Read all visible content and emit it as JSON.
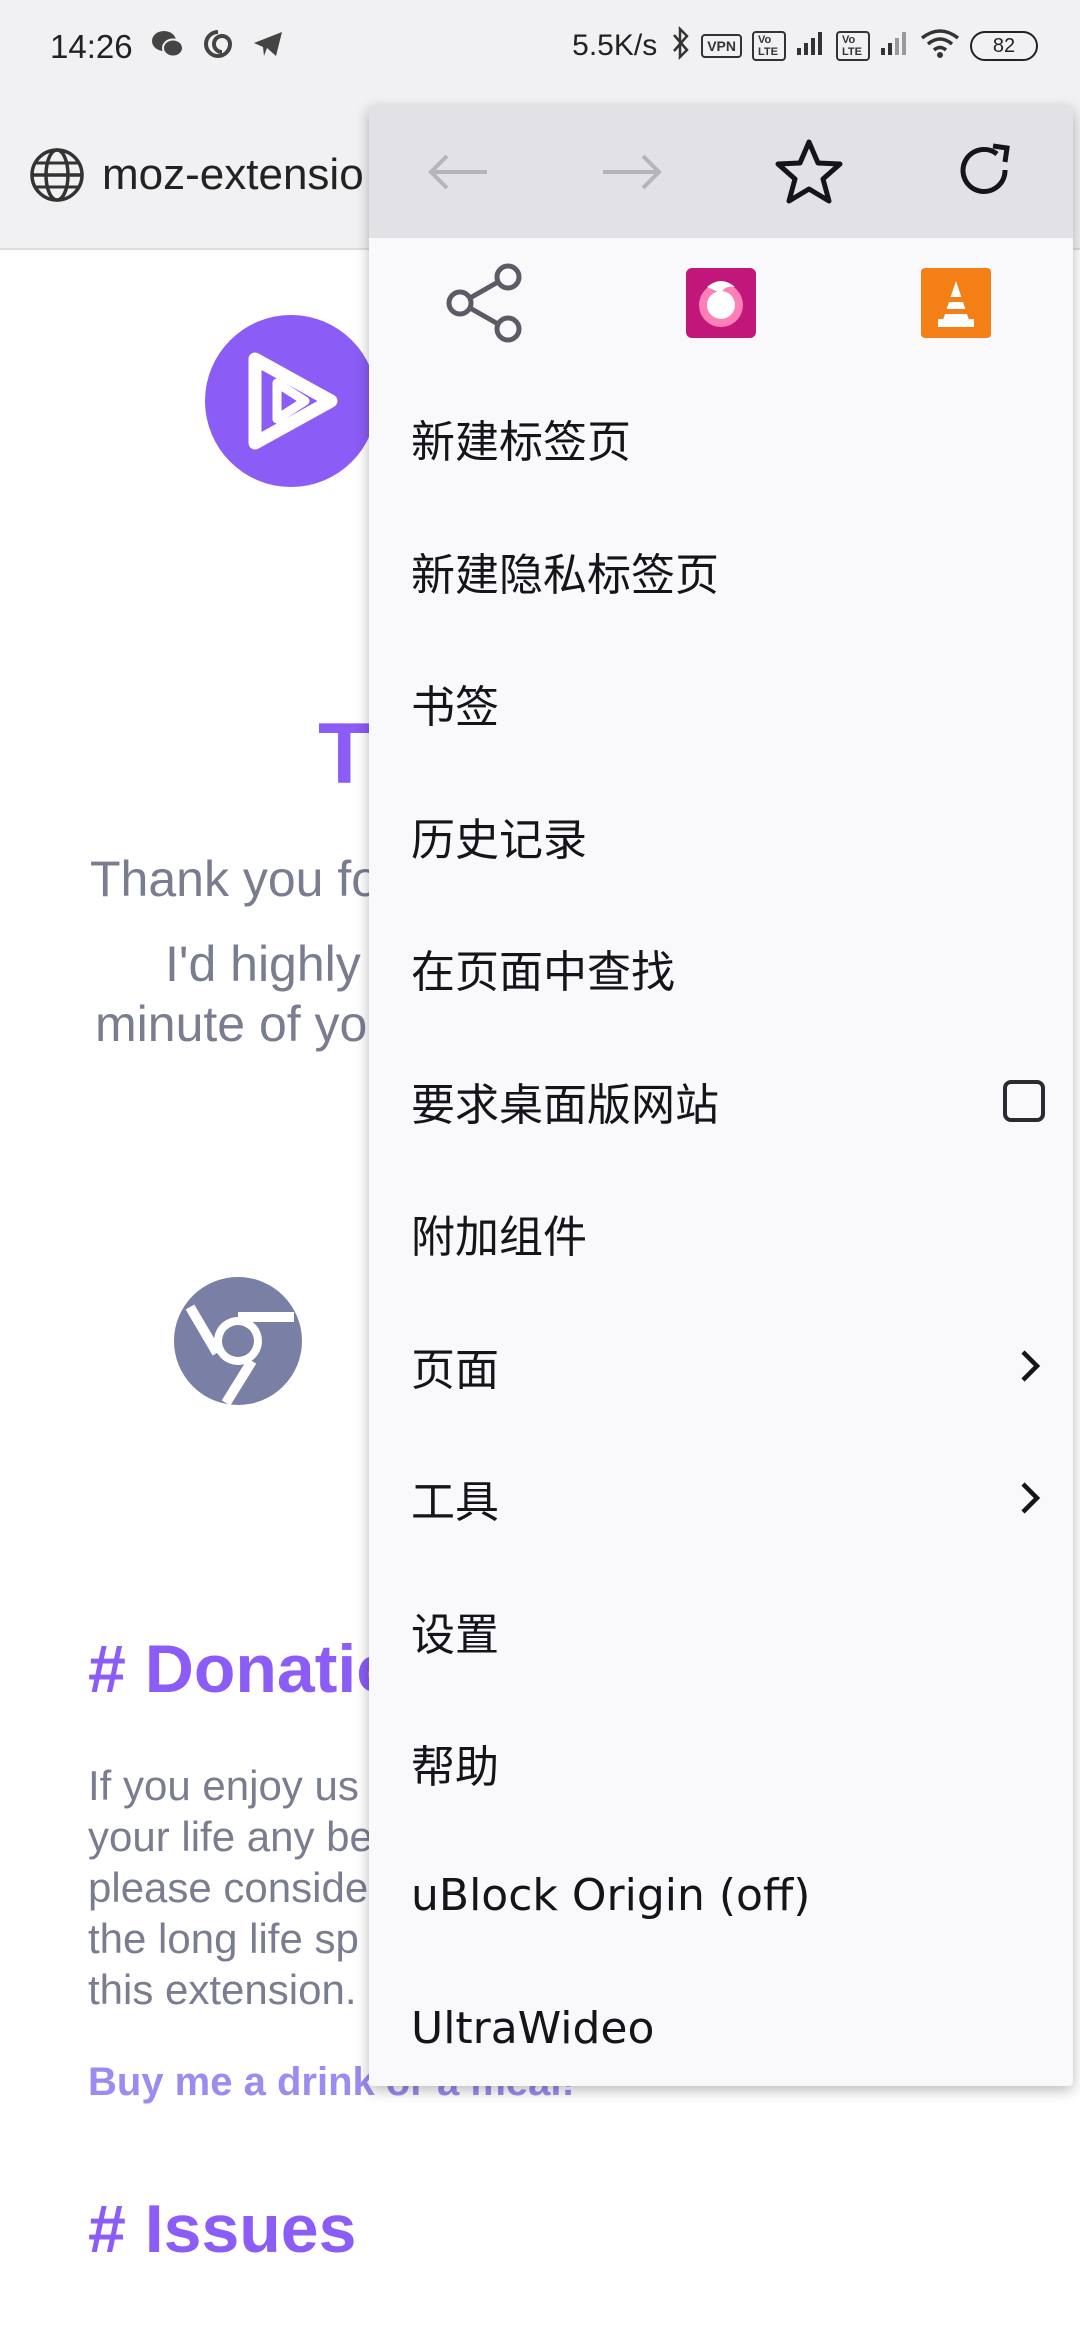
{
  "status_bar": {
    "time": "14:26",
    "speed": "5.5K/s",
    "vpn": "VPN",
    "volte1": "Vo LTE",
    "volte2": "Vo LTE",
    "battery": "82",
    "icons": [
      "wechat-icon",
      "hermes-icon",
      "telegram-icon",
      "bluetooth-icon",
      "signal-icon",
      "wifi-icon"
    ]
  },
  "url_bar": {
    "url": "moz-extensio"
  },
  "page": {
    "title_partial": "T",
    "thank_partial": "Thank you fo",
    "line1_partial": "I'd highly",
    "line2_partial": "minute of yo",
    "donation_heading": "Donatio",
    "donation_lines": [
      "If you enjoy us",
      "your life any be",
      "please conside",
      "the long life sp",
      "this extension."
    ],
    "donate_link": "Buy me a drink or a meal!",
    "issues_heading": "Issues",
    "hash": "#"
  },
  "menu": {
    "nav": [
      "back-icon",
      "forward-icon",
      "bookmark-star-icon",
      "reload-icon"
    ],
    "extensions": [
      "share-icon",
      "firefox-focus-icon",
      "vlc-icon"
    ],
    "items": [
      {
        "label": "新建标签页",
        "type": "plain"
      },
      {
        "label": "新建隐私标签页",
        "type": "plain"
      },
      {
        "label": "书签",
        "type": "plain"
      },
      {
        "label": "历史记录",
        "type": "plain"
      },
      {
        "label": "在页面中查找",
        "type": "plain"
      },
      {
        "label": "要求桌面版网站",
        "type": "checkbox",
        "checked": false
      },
      {
        "label": "附加组件",
        "type": "plain"
      },
      {
        "label": "页面",
        "type": "submenu"
      },
      {
        "label": "工具",
        "type": "submenu"
      },
      {
        "label": "设置",
        "type": "plain"
      },
      {
        "label": "帮助",
        "type": "plain"
      },
      {
        "label": "uBlock Origin (off)",
        "type": "plain"
      },
      {
        "label": "UltraWideo",
        "type": "plain"
      }
    ]
  },
  "colors": {
    "accent": "#8b5cf6",
    "muted_text": "#7a7d90",
    "menu_bg": "#f9f9fb",
    "menu_top_bg": "#e1e1e6"
  }
}
